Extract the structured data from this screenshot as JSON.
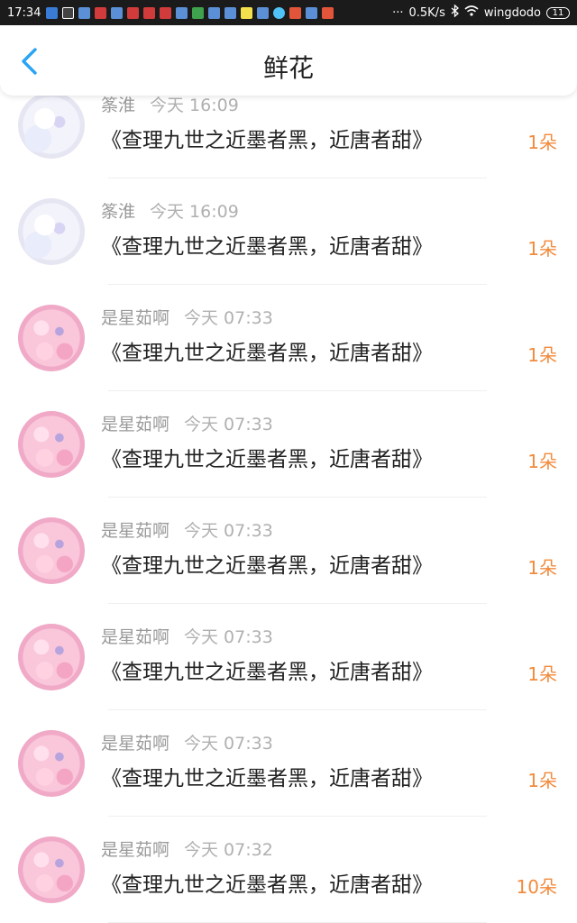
{
  "status_bar": {
    "time": "17:34",
    "network_speed": "0.5K/s",
    "wifi_name": "wingdodo",
    "battery": "11",
    "more": "···"
  },
  "header": {
    "title": "鲜花",
    "back_icon": "chevron-left-icon",
    "accent_color": "#2aa4f4"
  },
  "gifts": [
    {
      "user": "筿淮",
      "time": "今天 16:09",
      "book": "《查理九世之近墨者黑，近唐者甜》",
      "count": "1朵",
      "avatar": "blue"
    },
    {
      "user": "筿淮",
      "time": "今天 16:09",
      "book": "《查理九世之近墨者黑，近唐者甜》",
      "count": "1朵",
      "avatar": "blue"
    },
    {
      "user": "是星茹啊",
      "time": "今天 07:33",
      "book": "《查理九世之近墨者黑，近唐者甜》",
      "count": "1朵",
      "avatar": "pink"
    },
    {
      "user": "是星茹啊",
      "time": "今天 07:33",
      "book": "《查理九世之近墨者黑，近唐者甜》",
      "count": "1朵",
      "avatar": "pink"
    },
    {
      "user": "是星茹啊",
      "time": "今天 07:33",
      "book": "《查理九世之近墨者黑，近唐者甜》",
      "count": "1朵",
      "avatar": "pink"
    },
    {
      "user": "是星茹啊",
      "time": "今天 07:33",
      "book": "《查理九世之近墨者黑，近唐者甜》",
      "count": "1朵",
      "avatar": "pink"
    },
    {
      "user": "是星茹啊",
      "time": "今天 07:33",
      "book": "《查理九世之近墨者黑，近唐者甜》",
      "count": "1朵",
      "avatar": "pink"
    },
    {
      "user": "是星茹啊",
      "time": "今天 07:32",
      "book": "《查理九世之近墨者黑，近唐者甜》",
      "count": "10朵",
      "avatar": "pink"
    }
  ],
  "colors": {
    "count": "#f28a3c",
    "status_bar_bg": "#1b1b1b"
  }
}
